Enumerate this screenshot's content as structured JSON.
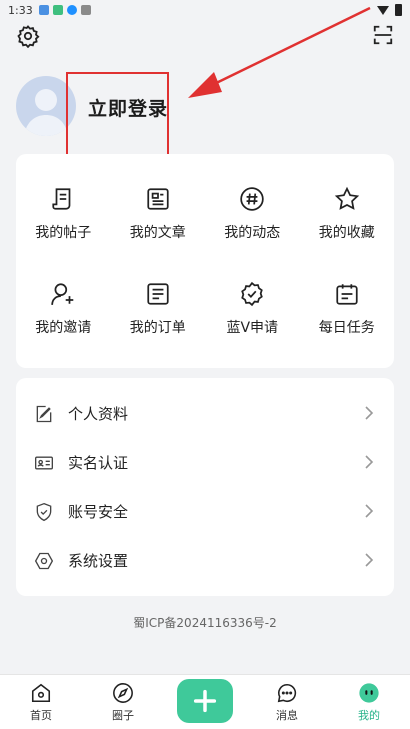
{
  "status_bar": {
    "time": "1:33"
  },
  "profile": {
    "login_label": "立即登录"
  },
  "grid": {
    "items": [
      {
        "label": "我的帖子",
        "icon": "scroll-icon"
      },
      {
        "label": "我的文章",
        "icon": "article-icon"
      },
      {
        "label": "我的动态",
        "icon": "hashtag-icon"
      },
      {
        "label": "我的收藏",
        "icon": "star-icon"
      },
      {
        "label": "我的邀请",
        "icon": "add-user-icon"
      },
      {
        "label": "我的订单",
        "icon": "order-icon"
      },
      {
        "label": "蓝V申请",
        "icon": "verified-badge-icon"
      },
      {
        "label": "每日任务",
        "icon": "calendar-icon"
      }
    ]
  },
  "settings_list": {
    "items": [
      {
        "label": "个人资料",
        "icon": "edit-doc-icon"
      },
      {
        "label": "实名认证",
        "icon": "id-card-icon"
      },
      {
        "label": "账号安全",
        "icon": "shield-icon"
      },
      {
        "label": "系统设置",
        "icon": "hexagon-gear-icon"
      }
    ]
  },
  "icp": "蜀ICP备2024116336号-2",
  "bottom_nav": {
    "items": [
      {
        "label": "首页",
        "icon": "home-icon"
      },
      {
        "label": "圈子",
        "icon": "compass-icon"
      },
      {
        "label": "",
        "icon": "plus-icon"
      },
      {
        "label": "消息",
        "icon": "chat-icon"
      },
      {
        "label": "我的",
        "icon": "me-icon",
        "active": true
      }
    ]
  },
  "colors": {
    "accent": "#3fc99a",
    "active_text": "#26b38a",
    "annotation": "#e03131",
    "background": "#f2f3f5"
  }
}
